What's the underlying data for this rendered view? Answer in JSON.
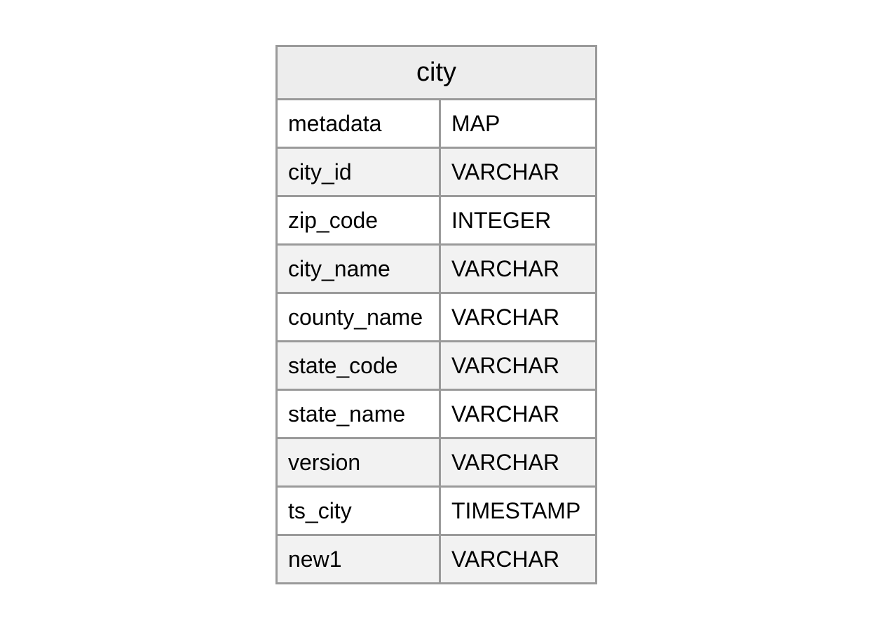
{
  "table": {
    "title": "city",
    "columns": [
      {
        "name": "metadata",
        "type": "MAP"
      },
      {
        "name": "city_id",
        "type": "VARCHAR"
      },
      {
        "name": "zip_code",
        "type": "INTEGER"
      },
      {
        "name": "city_name",
        "type": "VARCHAR"
      },
      {
        "name": "county_name",
        "type": "VARCHAR"
      },
      {
        "name": "state_code",
        "type": "VARCHAR"
      },
      {
        "name": "state_name",
        "type": "VARCHAR"
      },
      {
        "name": "version",
        "type": "VARCHAR"
      },
      {
        "name": "ts_city",
        "type": "TIMESTAMP"
      },
      {
        "name": "new1",
        "type": "VARCHAR"
      }
    ]
  }
}
